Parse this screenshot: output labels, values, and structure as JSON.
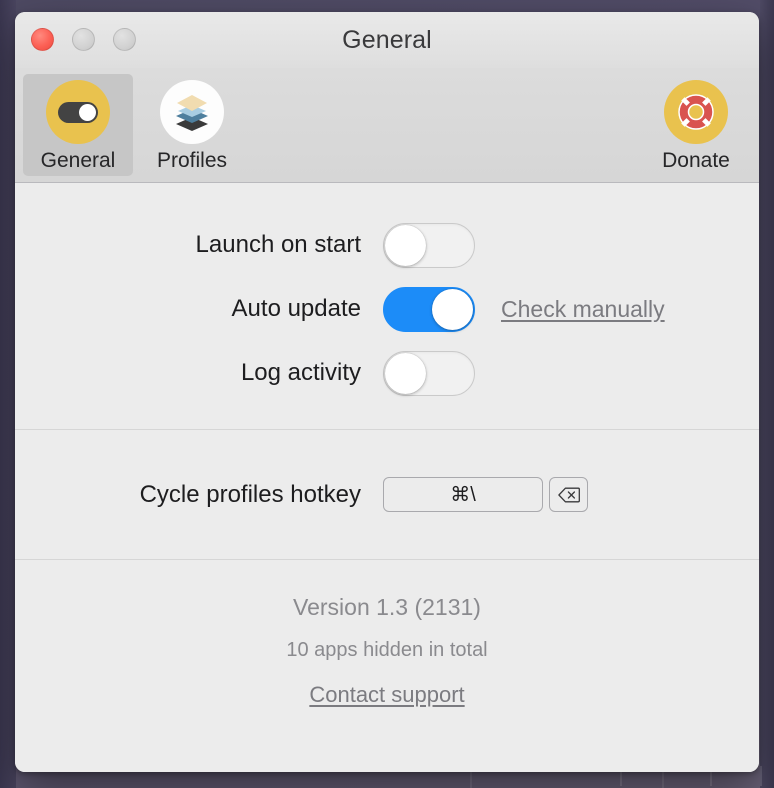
{
  "window": {
    "title": "General",
    "traffic_lights": [
      {
        "name": "close",
        "color": "#fc6055"
      },
      {
        "name": "minimize",
        "color": "#d2d2d2"
      },
      {
        "name": "maximize",
        "color": "#d2d2d2"
      }
    ]
  },
  "toolbar": {
    "items": [
      {
        "label": "General",
        "icon": "toggle-switch-icon",
        "selected": true
      },
      {
        "label": "Profiles",
        "icon": "stacked-layers-icon",
        "selected": false
      },
      {
        "label": "Donate",
        "icon": "life-preserver-icon",
        "selected": false
      }
    ]
  },
  "settings": {
    "rows": [
      {
        "label": "Launch on start",
        "state": "off"
      },
      {
        "label": "Auto update",
        "state": "on",
        "link": "Check manually"
      },
      {
        "label": "Log activity",
        "state": "off"
      }
    ]
  },
  "hotkey": {
    "label": "Cycle profiles hotkey",
    "value": "⌘\\",
    "clear_icon": "backspace-icon"
  },
  "footer": {
    "version": "Version 1.3 (2131)",
    "apps_hidden": "10 apps hidden in total",
    "support_link": "Contact support"
  },
  "colors": {
    "accent_on": "#1c8cf8",
    "icon_gold": "#e9c24e",
    "window_bg": "#ececec",
    "toolbar_bg": "#d8d8d8",
    "desktop_bg": "#55506b"
  }
}
